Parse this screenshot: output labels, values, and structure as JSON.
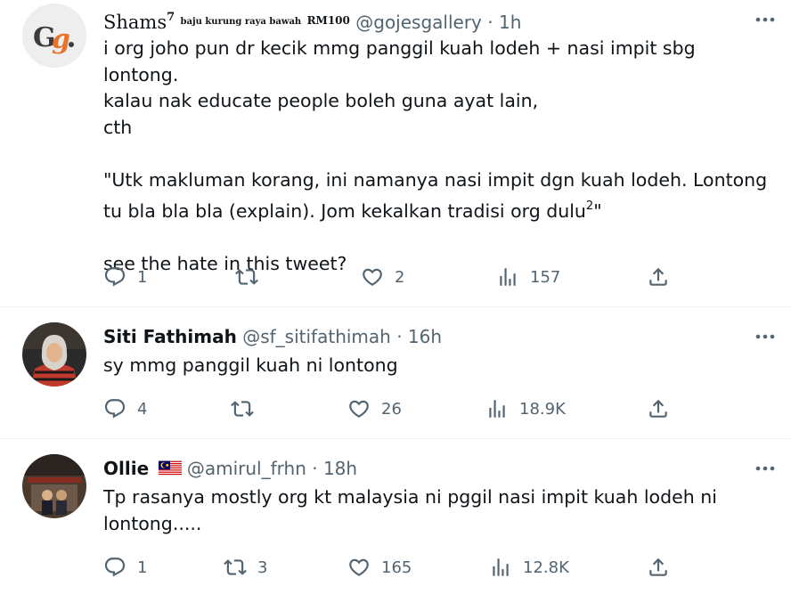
{
  "tweets": [
    {
      "display_name": "Shams",
      "name_sup": "7",
      "name_suffix": "baju kurung raya bawah",
      "name_suffix_end": "RM100",
      "handle": "@gojesgallery",
      "separator": "·",
      "time": "1h",
      "body": [
        "i org joho pun dr kecik mmg panggil kuah lodeh + nasi impit sbg lontong.",
        "kalau nak educate people boleh guna ayat lain,",
        "cth",
        "",
        "\"Utk makluman korang, ini namanya nasi impit dgn kuah lodeh. Lontong",
        "tu bla bla bla (explain). Jom kekalkan tradisi org dulu",
        "",
        "see the hate in this tweet?"
      ],
      "body_sup": "2",
      "body_quote_end": "\"",
      "avatar_text": "Gg.",
      "replies": "1",
      "retweets": "",
      "likes": "2",
      "views": "157"
    },
    {
      "display_name": "Siti Fathimah",
      "handle": "@sf_sitifathimah",
      "separator": "·",
      "time": "16h",
      "body": [
        "sy mmg panggil kuah ni lontong"
      ],
      "replies": "4",
      "retweets": "",
      "likes": "26",
      "views": "18.9K"
    },
    {
      "display_name": "Ollie",
      "handle": "@amirul_frhn",
      "separator": "·",
      "time": "18h",
      "body": [
        "Tp rasanya mostly org kt malaysia ni pggil nasi impit kuah lodeh ni",
        "lontong....."
      ],
      "replies": "1",
      "retweets": "3",
      "likes": "165",
      "views": "12.8K"
    }
  ],
  "icons": {
    "reply": "reply-icon",
    "retweet": "retweet-icon",
    "like": "heart-icon",
    "views": "views-chart-icon",
    "share": "share-icon",
    "more": "more-options-icon",
    "flag": "malaysia-flag-icon"
  },
  "colors": {
    "text": "#0f1419",
    "secondary": "#536471",
    "divider": "#eff3f4",
    "gojes_orange": "#e8742c"
  }
}
